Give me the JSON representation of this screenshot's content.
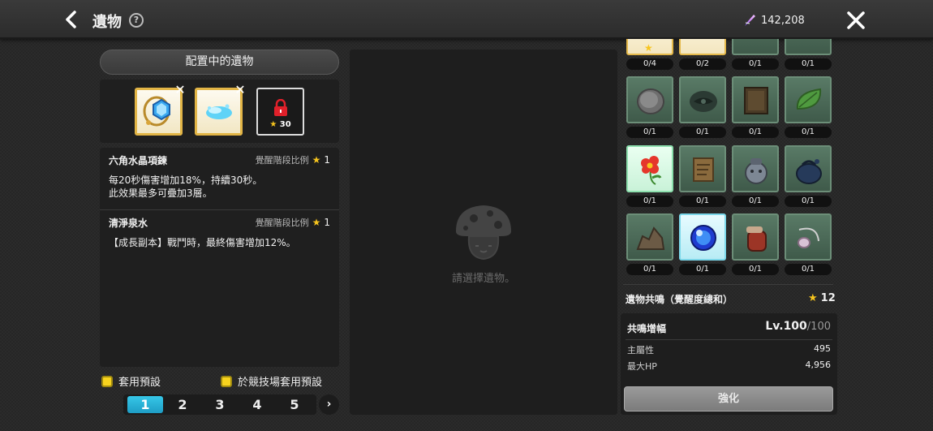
{
  "header": {
    "title": "遺物",
    "help_icon": "?",
    "currency_icon": "crystal-feather-icon",
    "currency_value": "142,208"
  },
  "equipped": {
    "header_label": "配置中的遺物",
    "slots": [
      {
        "state": "filled",
        "icon": "hexagon-necklace-icon"
      },
      {
        "state": "filled",
        "icon": "clear-spring-water-icon"
      },
      {
        "state": "locked",
        "requirement": "30"
      }
    ]
  },
  "descriptions": [
    {
      "name": "六角水晶項鍊",
      "ratio_label": "覺醒階段比例",
      "stars": "1",
      "text_lines": [
        "每20秒傷害增加18%，持續30秒。",
        "此效果最多可疊加3層。"
      ]
    },
    {
      "name": "清淨泉水",
      "ratio_label": "覺醒階段比例",
      "stars": "1",
      "text_lines": [
        "【成長副本】戰鬥時，最終傷害增加12%。"
      ]
    }
  ],
  "options": {
    "apply_preset": "套用預設",
    "apply_arena_preset": "於競技場套用預設"
  },
  "pager": {
    "pages": [
      "1",
      "2",
      "3",
      "4",
      "5"
    ],
    "active": "1",
    "next": "›"
  },
  "detail": {
    "placeholder": "請選擇遺物。"
  },
  "relic_grid": {
    "rows": [
      [
        {
          "count": "0/4",
          "style": "gold"
        },
        {
          "count": "0/2",
          "style": "gold"
        },
        {
          "count": "0/1",
          "style": "green"
        },
        {
          "count": "0/1",
          "style": "green"
        }
      ],
      [
        {
          "count": "0/1",
          "icon": "coin-icon"
        },
        {
          "count": "0/1",
          "icon": "dark-eye-stone-icon"
        },
        {
          "count": "0/1",
          "icon": "old-book-icon"
        },
        {
          "count": "0/1",
          "icon": "leaf-icon"
        }
      ],
      [
        {
          "count": "0/1",
          "icon": "red-flower-icon",
          "style": "green"
        },
        {
          "count": "0/1",
          "icon": "scroll-icon"
        },
        {
          "count": "0/1",
          "icon": "stone-jar-icon"
        },
        {
          "count": "0/1",
          "icon": "pouch-icon"
        }
      ],
      [
        {
          "count": "0/1",
          "icon": "rock-pile-icon"
        },
        {
          "count": "0/1",
          "icon": "blue-orb-icon",
          "style": "cyan"
        },
        {
          "count": "0/1",
          "icon": "potion-jar-icon"
        },
        {
          "count": "0/1",
          "icon": "pendant-icon"
        }
      ]
    ]
  },
  "resonance": {
    "label": "遺物共鳴（覺醒度總和）",
    "total": "12"
  },
  "boost": {
    "title": "共鳴增幅",
    "level": "Lv.100",
    "level_max": "/100",
    "stats": [
      {
        "label": "主屬性",
        "value": "495"
      },
      {
        "label": "最大HP",
        "value": "4,956"
      }
    ],
    "enhance_label": "強化"
  },
  "colors": {
    "accent_cyan": "#1e9dc5",
    "star_yellow": "#f7c51e",
    "checkbox_yellow": "#f7d31e",
    "lock_red": "#e0202a"
  }
}
